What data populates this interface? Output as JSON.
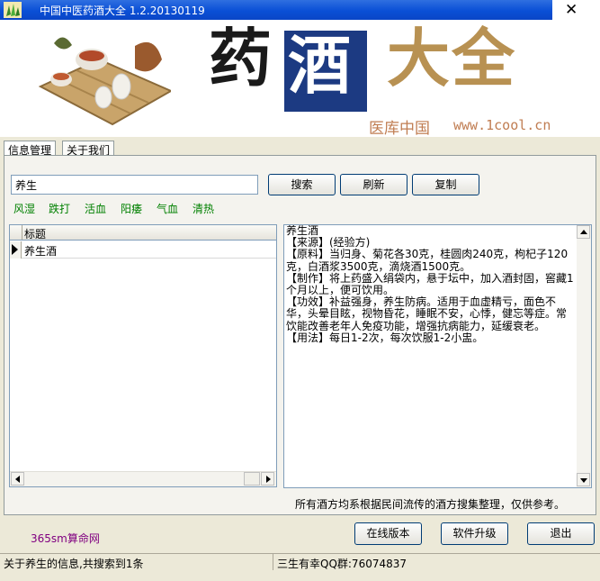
{
  "window": {
    "title": "中国中医药酒大全 1.2.20130119",
    "close_glyph": "✕"
  },
  "banner": {
    "yao": "药",
    "jiu": "酒",
    "daquan": "大全",
    "subtitle": "医库中国",
    "url": "www.1cool.cn"
  },
  "tabs": [
    "信息管理",
    "关于我们"
  ],
  "search": {
    "value": "养生",
    "buttons": {
      "search": "搜索",
      "refresh": "刷新",
      "copy": "复制"
    }
  },
  "categories": [
    "风湿",
    "跌打",
    "活血",
    "阳痿",
    "气血",
    "清热"
  ],
  "grid": {
    "header": "标题",
    "rows": [
      "养生酒"
    ]
  },
  "detail": "养生酒\n【来源】(经验方)\n【原料】当归身、菊花各30克，桂圆肉240克，枸杞子120克，白酒浆3500克，滴烧酒1500克。\n【制作】将上药盛入绢袋内，悬于坛中，加入酒封固，窖藏1个月以上，便可饮用。\n【功效】补益强身，养生防病。适用于血虚精亏，面色不华，头晕目眩，视物昏花，睡眠不安，心悸，健忘等症。常饮能改善老年人免疫功能，增强抗病能力，延缓衰老。\n【用法】每日1-2次，每次饮服1-2小盅。",
  "disclaimer": "所有酒方均系根据民间流传的酒方搜集整理，仅供参考。",
  "footer": {
    "site": "365sm算命网",
    "buttons": {
      "online": "在线版本",
      "upgrade": "软件升级",
      "exit": "退出"
    }
  },
  "status": {
    "left": "关于养生的信息,共搜索到1条",
    "right": "三生有幸QQ群:76074837"
  },
  "colors": {
    "titlebar": "#0a4fd6",
    "category_text": "#008000",
    "site_text": "#800080",
    "banner_blue": "#1c3a82",
    "banner_gold": "#b89152"
  }
}
